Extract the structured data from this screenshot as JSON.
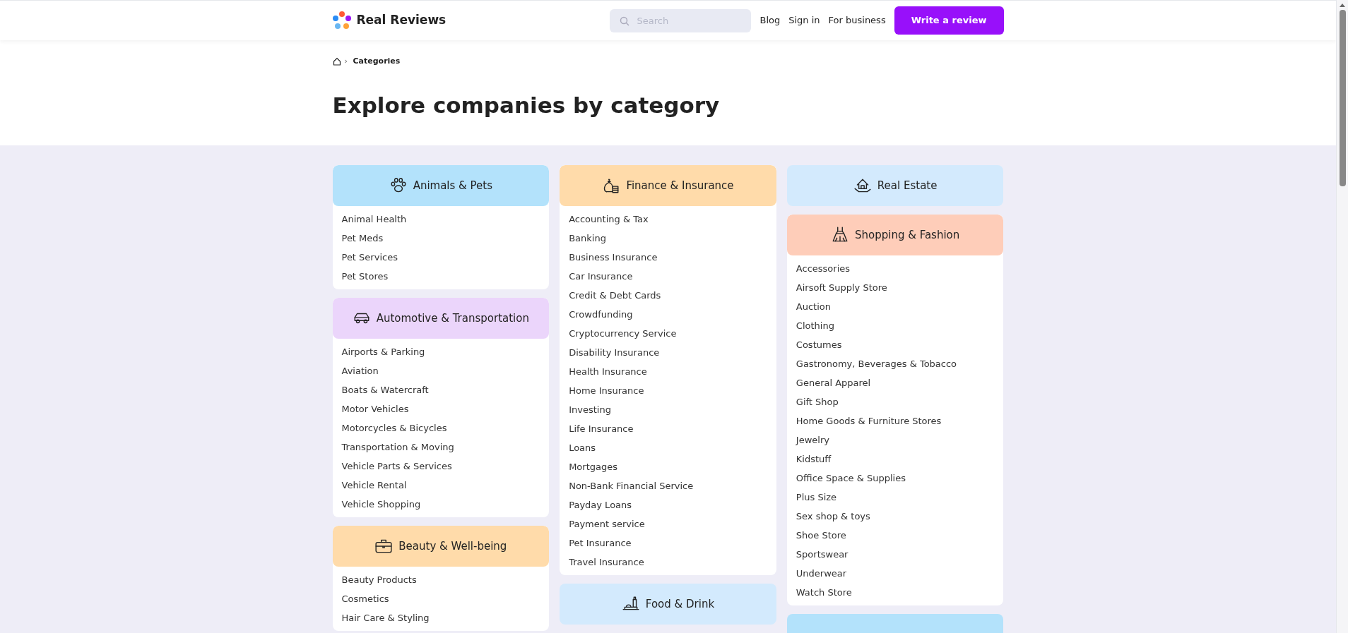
{
  "header": {
    "logo": "Real Reviews",
    "search": {
      "placeholder": "Search"
    },
    "nav": [
      "Blog",
      "Sign in",
      "For business"
    ],
    "cta": "Write a review"
  },
  "breadcrumb": [
    "Categories"
  ],
  "heading": "Explore companies by category",
  "columns": [
    [
      {
        "title": "Animals & Pets",
        "color": "#b3e2fb",
        "items": [
          "Animal Health",
          "Pet Meds",
          "Pet Services",
          "Pet Stores"
        ]
      },
      {
        "title": "Automotive & Transportation",
        "color": "#ebd5fb",
        "items": [
          "Airports & Parking",
          "Aviation",
          "Boats & Watercraft",
          "Motor Vehicles",
          "Motorcycles & Bicycles",
          "Transportation & Moving",
          "Vehicle Parts & Services",
          "Vehicle Rental",
          "Vehicle Shopping"
        ]
      },
      {
        "title": "Beauty & Well-being",
        "color": "#ffdbaa",
        "items": [
          "Beauty Products",
          "Cosmetics",
          "Hair Care & Styling"
        ]
      }
    ],
    [
      {
        "title": "Finance & Insurance",
        "color": "#ffdbaa",
        "items": [
          "Accounting & Tax",
          "Banking",
          "Business Insurance",
          "Car Insurance",
          "Credit & Debt Cards",
          "Crowdfunding",
          "Cryptocurrency Service",
          "Disability Insurance",
          "Health Insurance",
          "Home Insurance",
          "Investing",
          "Life Insurance",
          "Loans",
          "Mortgages",
          "Non-Bank Financial Service",
          "Payday Loans",
          "Payment service",
          "Pet Insurance",
          "Travel Insurance"
        ]
      },
      {
        "title": "Food & Drink",
        "color": "#d3eafd"
      }
    ],
    [
      {
        "title": "Real Estate",
        "color": "#d3eafd"
      },
      {
        "title": "Shopping & Fashion",
        "color": "#fecdb9",
        "items": [
          "Accessories",
          "Airsoft Supply Store",
          "Auction",
          "Clothing",
          "Costumes",
          "Gastronomy, Beverages & Tobacco",
          "General Apparel",
          "Gift Shop",
          "Home Goods & Furniture Stores",
          "Jewelry",
          "Kidstuff",
          "Office Space & Supplies",
          "Plus Size",
          "Sex shop & toys",
          "Shoe Store",
          "Sportswear",
          "Underwear",
          "Watch Store"
        ]
      },
      {
        "color": "#b3e2fb"
      }
    ]
  ]
}
